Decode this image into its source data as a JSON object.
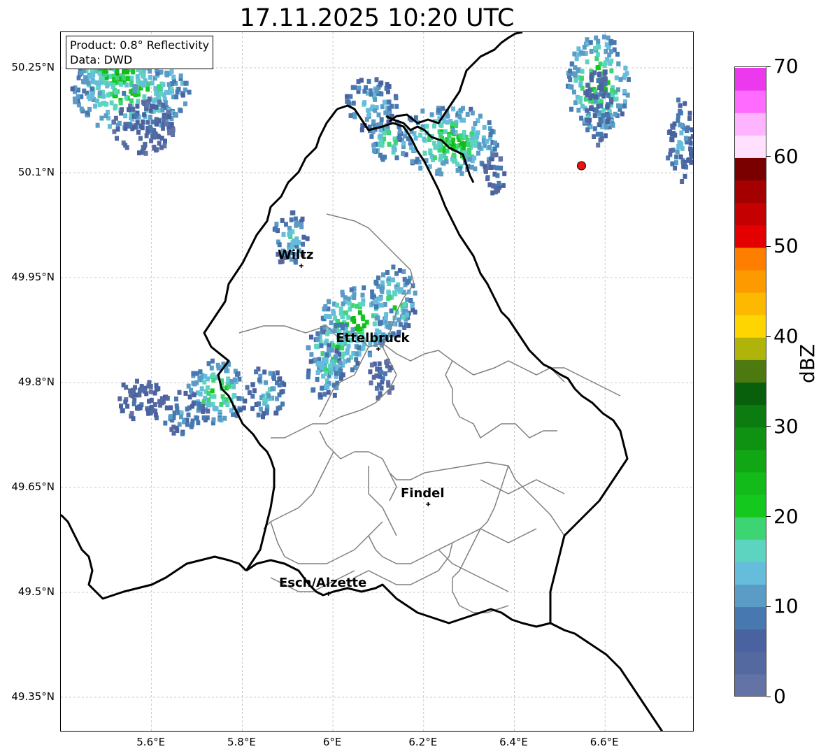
{
  "title": "17.11.2025 10:20 UTC",
  "info": {
    "product": "Product: 0.8° Reflectivity",
    "data": "Data: DWD"
  },
  "axes": {
    "lon_range": [
      5.4,
      6.8
    ],
    "lat_range": [
      49.3,
      50.3
    ],
    "x_ticks": [
      {
        "value": 5.6,
        "label": "5.6°E"
      },
      {
        "value": 5.8,
        "label": "5.8°E"
      },
      {
        "value": 6.0,
        "label": "6°E"
      },
      {
        "value": 6.2,
        "label": "6.2°E"
      },
      {
        "value": 6.4,
        "label": "6.4°E"
      },
      {
        "value": 6.6,
        "label": "6.6°E"
      }
    ],
    "y_ticks": [
      {
        "value": 50.25,
        "label": "50.25°N"
      },
      {
        "value": 50.1,
        "label": "50.1°N"
      },
      {
        "value": 49.95,
        "label": "49.95°N"
      },
      {
        "value": 49.8,
        "label": "49.8°N"
      },
      {
        "value": 49.65,
        "label": "49.65°N"
      },
      {
        "value": 49.5,
        "label": "49.5°N"
      },
      {
        "value": 49.35,
        "label": "49.35°N"
      }
    ],
    "grid": "dashed light gray"
  },
  "cities": [
    {
      "name": "Wiltz",
      "lon": 5.93,
      "lat": 49.967
    },
    {
      "name": "Ettelbruck",
      "lon": 6.1,
      "lat": 49.848
    },
    {
      "name": "Findel",
      "lon": 6.21,
      "lat": 49.626
    },
    {
      "name": "Esch/Alzette",
      "lon": 5.99,
      "lat": 49.498
    }
  ],
  "radar_marker": {
    "lon": 6.548,
    "lat": 50.11,
    "color": "#ee1111"
  },
  "colorbar": {
    "title": "dBZ",
    "min": 0,
    "max": 70,
    "step": 2.5,
    "tick_labels": [
      "0",
      "10",
      "20",
      "30",
      "40",
      "50",
      "60",
      "70"
    ],
    "colors": [
      "#6373a5",
      "#53699f",
      "#4a62a0",
      "#4878b0",
      "#5b9cc6",
      "#66bcdb",
      "#5dd4c0",
      "#3dd574",
      "#14c81d",
      "#12bb1a",
      "#10a614",
      "#0f9112",
      "#0c7c10",
      "#08600c",
      "#4d7a10",
      "#b0b30a",
      "#fed500",
      "#fdb900",
      "#fd9a00",
      "#fe7f00",
      "#e40000",
      "#c50000",
      "#a50000",
      "#7a0000",
      "#ffe1ff",
      "#ffb4ff",
      "#ff6aff",
      "#ed39ed"
    ]
  },
  "echo_cells": [
    {
      "lon": 5.55,
      "lat": 50.22,
      "rlon": 0.13,
      "rlat": 0.06,
      "dbz": 22
    },
    {
      "lon": 5.58,
      "lat": 50.17,
      "rlon": 0.07,
      "rlat": 0.04,
      "dbz": 8
    },
    {
      "lon": 5.52,
      "lat": 50.25,
      "rlon": 0.09,
      "rlat": 0.035,
      "dbz": 26
    },
    {
      "lon": 6.25,
      "lat": 50.15,
      "rlon": 0.11,
      "rlat": 0.05,
      "dbz": 23
    },
    {
      "lon": 6.27,
      "lat": 50.14,
      "rlon": 0.05,
      "rlat": 0.025,
      "dbz": 30
    },
    {
      "lon": 6.08,
      "lat": 50.2,
      "rlon": 0.06,
      "rlat": 0.04,
      "dbz": 16
    },
    {
      "lon": 6.12,
      "lat": 50.15,
      "rlon": 0.04,
      "rlat": 0.03,
      "dbz": 22
    },
    {
      "lon": 6.58,
      "lat": 50.23,
      "rlon": 0.07,
      "rlat": 0.07,
      "dbz": 24
    },
    {
      "lon": 6.58,
      "lat": 50.2,
      "rlon": 0.03,
      "rlat": 0.06,
      "dbz": 10
    },
    {
      "lon": 6.76,
      "lat": 50.15,
      "rlon": 0.03,
      "rlat": 0.06,
      "dbz": 12
    },
    {
      "lon": 6.35,
      "lat": 50.1,
      "rlon": 0.03,
      "rlat": 0.03,
      "dbz": 8
    },
    {
      "lon": 5.9,
      "lat": 50.01,
      "rlon": 0.04,
      "rlat": 0.04,
      "dbz": 16
    },
    {
      "lon": 6.05,
      "lat": 49.89,
      "rlon": 0.08,
      "rlat": 0.05,
      "dbz": 24
    },
    {
      "lon": 6.0,
      "lat": 49.85,
      "rlon": 0.06,
      "rlat": 0.04,
      "dbz": 22
    },
    {
      "lon": 6.13,
      "lat": 49.92,
      "rlon": 0.05,
      "rlat": 0.05,
      "dbz": 20
    },
    {
      "lon": 5.98,
      "lat": 49.82,
      "rlon": 0.04,
      "rlat": 0.04,
      "dbz": 18
    },
    {
      "lon": 5.74,
      "lat": 49.79,
      "rlon": 0.07,
      "rlat": 0.045,
      "dbz": 22
    },
    {
      "lon": 5.66,
      "lat": 49.76,
      "rlon": 0.06,
      "rlat": 0.03,
      "dbz": 12
    },
    {
      "lon": 5.57,
      "lat": 49.78,
      "rlon": 0.05,
      "rlat": 0.03,
      "dbz": 8
    },
    {
      "lon": 5.85,
      "lat": 49.79,
      "rlon": 0.04,
      "rlat": 0.04,
      "dbz": 16
    },
    {
      "lon": 6.1,
      "lat": 49.81,
      "rlon": 0.03,
      "rlat": 0.03,
      "dbz": 8
    }
  ]
}
